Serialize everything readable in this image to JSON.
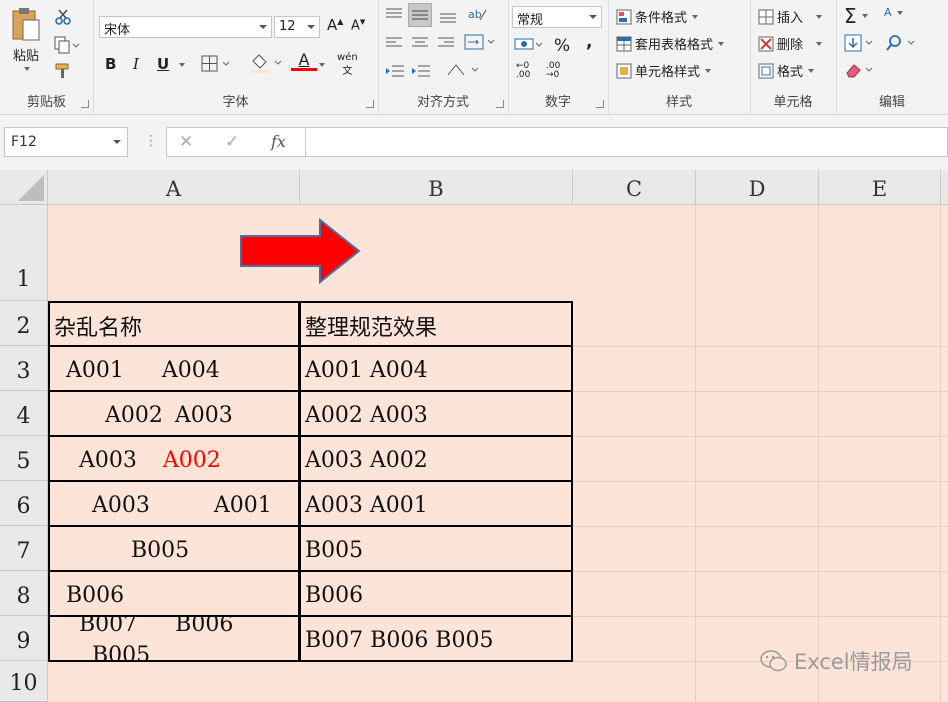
{
  "ribbon": {
    "clipboard": {
      "paste_label": "粘贴",
      "group_label": "剪贴板"
    },
    "font": {
      "font_name": "宋体",
      "font_size": "12",
      "bold": "B",
      "italic": "I",
      "underline": "U",
      "group_label": "字体",
      "phonetic": "wén",
      "font_color": "#ff0000"
    },
    "alignment": {
      "group_label": "对齐方式"
    },
    "number": {
      "format": "常规",
      "percent": "%",
      "comma": ",",
      "group_label": "数字"
    },
    "styles": {
      "conditional": "条件格式",
      "table": "套用表格格式",
      "cell_styles": "单元格样式",
      "group_label": "样式"
    },
    "cells": {
      "insert": "插入",
      "delete": "删除",
      "format": "格式",
      "group_label": "单元格"
    },
    "editing": {
      "group_label": "编辑"
    }
  },
  "formula_bar": {
    "name_box": "F12",
    "fx": "fx",
    "cancel": "✕",
    "confirm": "✓",
    "value": ""
  },
  "sheet": {
    "columns": [
      "A",
      "B",
      "C",
      "D",
      "E"
    ],
    "rows": [
      "1",
      "2",
      "3",
      "4",
      "5",
      "6",
      "7",
      "8",
      "9",
      "10"
    ],
    "header_a": "杂乱名称",
    "header_b": "整理规范效果",
    "messy": [
      [
        "A001",
        "A004"
      ],
      [
        "A002",
        "A003"
      ],
      [
        "A003",
        "A002"
      ],
      [
        "A003",
        "A001"
      ],
      [
        "B005"
      ],
      [
        "B006"
      ],
      [
        "B007",
        "B006",
        "B005"
      ]
    ],
    "clean": [
      "A001 A004",
      "A002 A003",
      "A003 A002",
      "A003 A001",
      "B005",
      "B006",
      "B007 B006 B005"
    ],
    "highlight_color": "#ff0000",
    "fill_color": "#fde4d8"
  },
  "watermark": "Excel情报局"
}
